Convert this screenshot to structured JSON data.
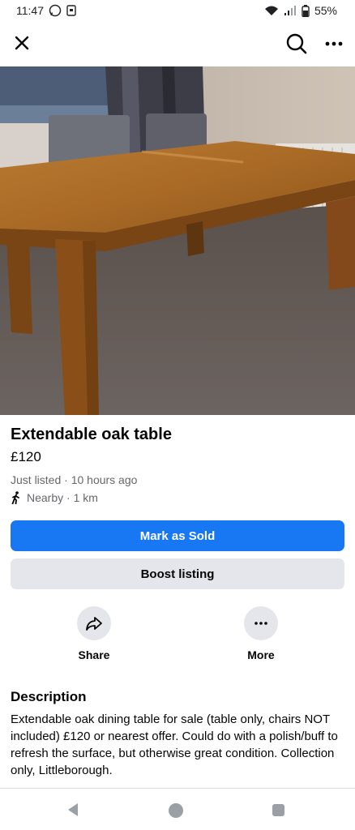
{
  "status_bar": {
    "time": "11:47",
    "battery": "55%",
    "icons": [
      "whatsapp-icon",
      "notification-icon",
      "wifi-icon",
      "signal-icon",
      "battery-icon"
    ]
  },
  "app_bar": {
    "icons": [
      "close-icon",
      "search-icon",
      "more-icon"
    ]
  },
  "photo": {
    "subject": "listing-photo"
  },
  "listing": {
    "title": "Extendable oak table",
    "price": "£120",
    "listed": "Just listed · 10 hours ago",
    "location": "Nearby · 1 km"
  },
  "buttons": {
    "mark_sold": "Mark as Sold",
    "boost": "Boost listing"
  },
  "actions": {
    "share": "Share",
    "more": "More"
  },
  "description": {
    "heading": "Description",
    "body": "Extendable oak dining table for sale (table only, chairs NOT included) £120 or nearest offer. Could do with a polish/buff to refresh the surface, but otherwise great condition. Collection only, Littleborough."
  },
  "nav_bar": {
    "icons": [
      "back-icon",
      "home-icon",
      "recents-icon"
    ]
  },
  "colors": {
    "primary": "#1877f2",
    "secondary_button": "#e4e6eb",
    "muted_text": "#65676b"
  }
}
